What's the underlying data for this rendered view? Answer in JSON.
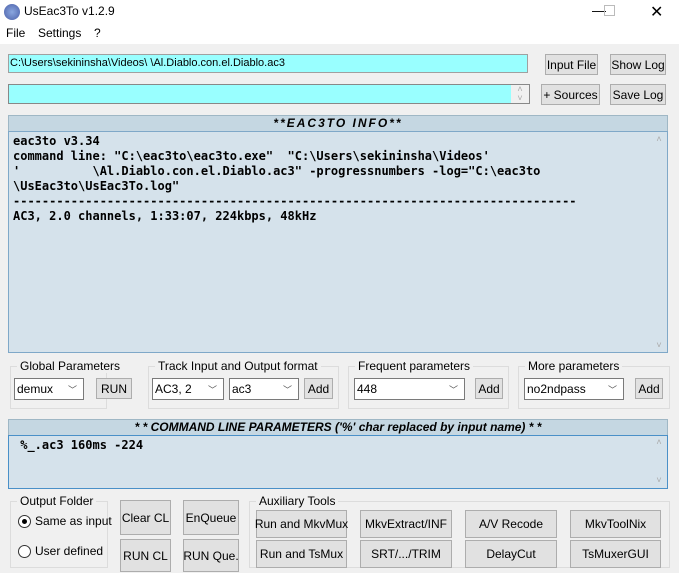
{
  "window": {
    "title": "UsEac3To v1.2.9"
  },
  "menu": [
    "File",
    "Settings",
    "?"
  ],
  "input_path": "C:\\Users\\sekininsha\\Videos\\                              \\Al.Diablo.con.el.Diablo.ac3",
  "sources_value": "",
  "buttons": {
    "input_file": "Input File",
    "show_log": "Show Log",
    "sources": "+ Sources",
    "save_log": "Save Log"
  },
  "info": {
    "header": "**EAC3TO INFO**",
    "text": "eac3to v3.34\ncommand line: \"C:\\eac3to\\eac3to.exe\"  \"C:\\Users\\sekininsha\\Videos'\n'          \\Al.Diablo.con.el.Diablo.ac3\" -progressnumbers -log=\"C:\\eac3to\n\\UsEac3to\\UsEac3To.log\"\n------------------------------------------------------------------------------\nAC3, 2.0 channels, 1:33:07, 224kbps, 48kHz"
  },
  "global": {
    "label": "Global Parameters",
    "value": "demux",
    "run": "RUN"
  },
  "track": {
    "label": "Track Input and Output format",
    "input": "AC3, 2",
    "output": "ac3",
    "add": "Add"
  },
  "frequent": {
    "label": "Frequent parameters",
    "value": "448",
    "add": "Add"
  },
  "more": {
    "label": "More parameters",
    "value": "no2ndpass",
    "add": "Add"
  },
  "cmd": {
    "header": "* * COMMAND LINE PARAMETERS ('%' char replaced by input name) * *",
    "value": " %_.ac3 160ms -224"
  },
  "output_folder": {
    "label": "Output Folder",
    "options": [
      "Same as input",
      "User defined"
    ],
    "selected": 0
  },
  "actions": {
    "clear_cl": "Clear CL",
    "enqueue": "EnQueue",
    "run_cl": "RUN CL",
    "run_queue": "RUN Que."
  },
  "aux": {
    "label": "Auxiliary Tools",
    "buttons": [
      "Run and MkvMux",
      "MkvExtract/INF",
      "A/V Recode",
      "MkvToolNix",
      "Run and TsMux",
      "SRT/.../TRIM",
      "DelayCut",
      "TsMuxerGUI"
    ]
  }
}
